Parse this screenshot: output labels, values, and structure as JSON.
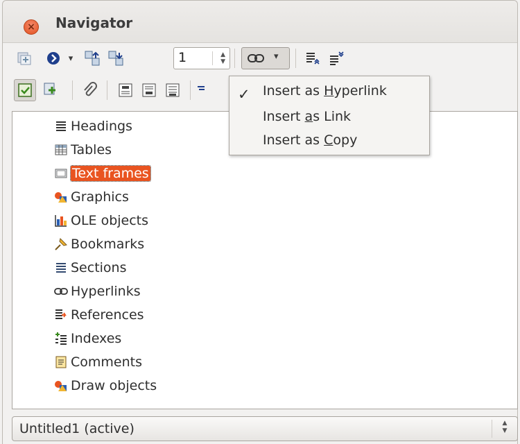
{
  "window": {
    "title": "Navigator",
    "close_glyph": "×"
  },
  "toolbar": {
    "page_number": "1",
    "spin_up": "▲",
    "spin_down": "▼",
    "dropdown_glyph": "▾"
  },
  "drag_menu": {
    "check_glyph": "✓",
    "items": [
      {
        "label_pre": "Insert as ",
        "accel": "H",
        "label_post": "yperlink",
        "checked": true
      },
      {
        "label_pre": "Insert ",
        "accel": "a",
        "label_post": "s Link",
        "checked": false
      },
      {
        "label_pre": "Insert as ",
        "accel": "C",
        "label_post": "opy",
        "checked": false
      }
    ]
  },
  "tree": {
    "items": [
      {
        "label": "Headings",
        "icon": "headings-icon"
      },
      {
        "label": "Tables",
        "icon": "table-icon"
      },
      {
        "label": "Text frames",
        "icon": "text-frame-icon",
        "selected": true
      },
      {
        "label": "Graphics",
        "icon": "graphics-icon"
      },
      {
        "label": "OLE objects",
        "icon": "ole-object-icon"
      },
      {
        "label": "Bookmarks",
        "icon": "bookmark-icon"
      },
      {
        "label": "Sections",
        "icon": "sections-icon"
      },
      {
        "label": "Hyperlinks",
        "icon": "hyperlink-icon"
      },
      {
        "label": "References",
        "icon": "references-icon"
      },
      {
        "label": "Indexes",
        "icon": "indexes-icon"
      },
      {
        "label": "Comments",
        "icon": "comment-icon"
      },
      {
        "label": "Draw objects",
        "icon": "draw-objects-icon"
      }
    ]
  },
  "document_selector": {
    "value": "Untitled1 (active)",
    "up": "▲",
    "down": "▼"
  },
  "colors": {
    "accent": "#e95420",
    "background": "#f2f1f0"
  }
}
